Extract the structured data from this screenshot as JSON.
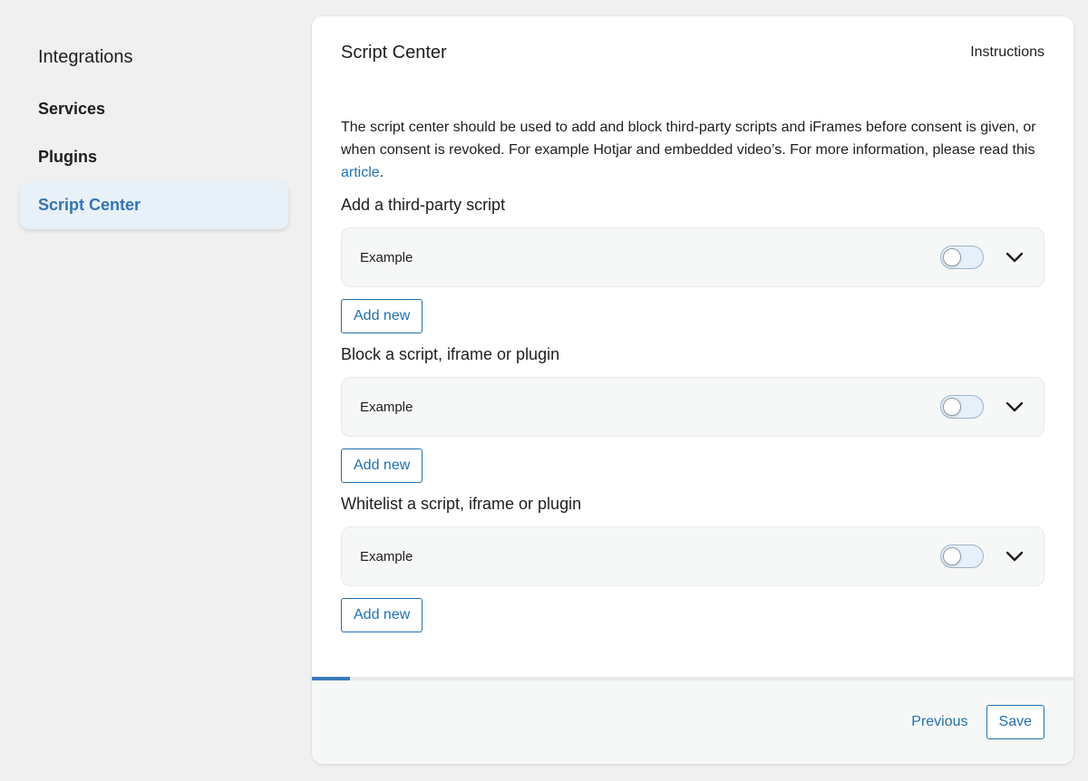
{
  "sidebar": {
    "heading": "Integrations",
    "items": [
      {
        "label": "Services"
      },
      {
        "label": "Plugins"
      },
      {
        "label": "Script Center"
      }
    ]
  },
  "panel": {
    "title": "Script Center",
    "instructions_label": "Instructions",
    "intro_text": "The script center should be used to add and block third-party scripts and iFrames before consent is given, or when consent is revoked. For example Hotjar and embedded video’s. For more information, please read this ",
    "intro_link": "article",
    "intro_end": ".",
    "sections": [
      {
        "title": "Add a third-party script",
        "item_label": "Example",
        "enabled": false,
        "add_label": "Add new"
      },
      {
        "title": "Block a script, iframe or plugin",
        "item_label": "Example",
        "enabled": false,
        "add_label": "Add new"
      },
      {
        "title": "Whitelist a script, iframe or plugin",
        "item_label": "Example",
        "enabled": false,
        "add_label": "Add new"
      }
    ]
  },
  "footer": {
    "progress_fraction": 0.05,
    "previous_label": "Previous",
    "save_label": "Save"
  },
  "colors": {
    "accent": "#2271b1",
    "active_bg": "#e8f0f8",
    "progress": "#3a7bbf"
  }
}
